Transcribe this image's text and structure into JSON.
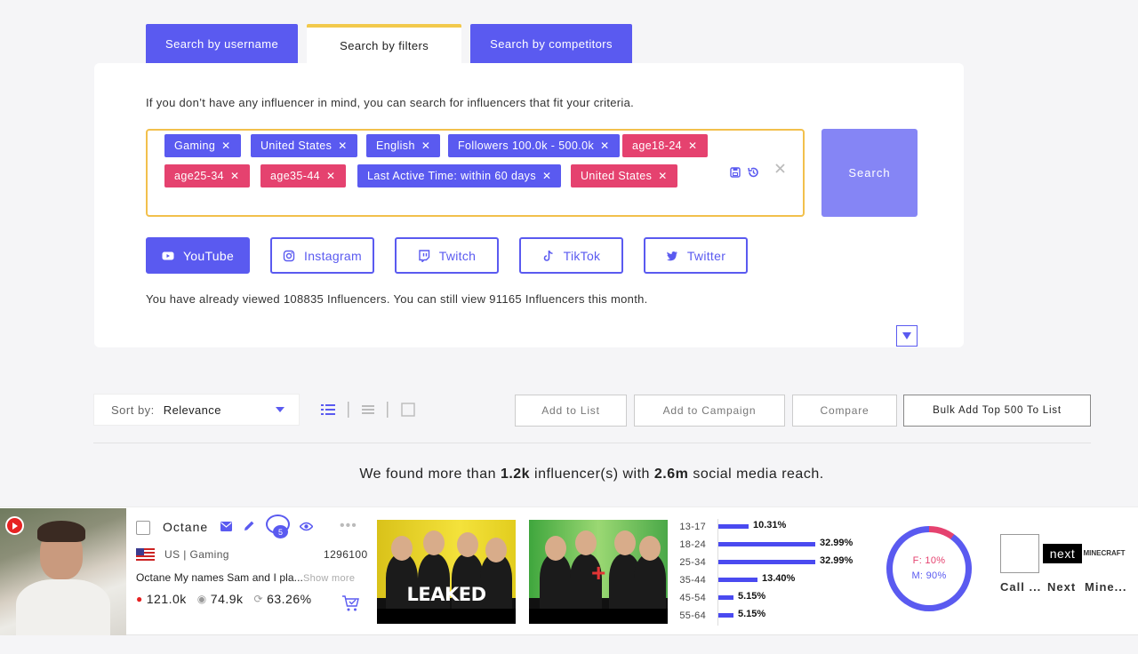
{
  "tabs": [
    {
      "label": "Search by username"
    },
    {
      "label": "Search by filters"
    },
    {
      "label": "Search by competitors"
    }
  ],
  "intro_text": "If you don’t have any influencer in mind, you can search for influencers that fit your criteria.",
  "filters": [
    {
      "label": "Gaming",
      "color": "#5a5af0"
    },
    {
      "label": "United States",
      "color": "#5a5af0"
    },
    {
      "label": "English",
      "color": "#5a5af0"
    },
    {
      "label": "Followers 100.0k - 500.0k",
      "color": "#5a5af0"
    },
    {
      "label": "age18-24",
      "color": "#e5426f"
    },
    {
      "label": "age25-34",
      "color": "#e5426f"
    },
    {
      "label": "age35-44",
      "color": "#e5426f"
    },
    {
      "label": "Last Active Time: within 60 days",
      "color": "#5a5af0"
    },
    {
      "label": "United States",
      "color": "#e5426f"
    }
  ],
  "remove_glyph": "✕",
  "search_button": "Search",
  "platforms": [
    {
      "label": "YouTube",
      "icon": "youtube-icon",
      "selected": true
    },
    {
      "label": "Instagram",
      "icon": "instagram-icon",
      "selected": false
    },
    {
      "label": "Twitch",
      "icon": "twitch-icon",
      "selected": false
    },
    {
      "label": "TikTok",
      "icon": "tiktok-icon",
      "selected": false
    },
    {
      "label": "Twitter",
      "icon": "twitter-icon",
      "selected": false
    }
  ],
  "viewed_text": "You have already viewed 108835 Influencers. You can still view 91165 Influencers this month.",
  "sort": {
    "label": "Sort by:",
    "value": "Relevance"
  },
  "actions": {
    "add_to_list": "Add to List",
    "add_to_campaign": "Add to Campaign",
    "compare": "Compare",
    "bulk_add": "Bulk Add Top 500 To List"
  },
  "results": {
    "prefix": "We found more than ",
    "count": "1.2k",
    "middle": " influencer(s) with ",
    "reach": "2.6m",
    "suffix": " social media reach."
  },
  "influencer": {
    "name": "Octane",
    "comment_count": "5",
    "country": "US | Gaming",
    "subscribers": "1296100",
    "description": "Octane My names Sam and I pla...",
    "show_more": "Show more",
    "followers": "121.0k",
    "avg_views": "74.9k",
    "engagement": "63.26%",
    "thumb1_text": "LEAKED",
    "thumb2_mark": "+",
    "ages": [
      {
        "label": "13-17",
        "value": "10.31%",
        "pct": 10.31
      },
      {
        "label": "18-24",
        "value": "32.99%",
        "pct": 32.99
      },
      {
        "label": "25-34",
        "value": "32.99%",
        "pct": 32.99
      },
      {
        "label": "35-44",
        "value": "13.40%",
        "pct": 13.4
      },
      {
        "label": "45-54",
        "value": "5.15%",
        "pct": 5.15
      },
      {
        "label": "55-64",
        "value": "5.15%",
        "pct": 5.15
      }
    ],
    "gender": {
      "female": "F: 10%",
      "male": "M: 90%",
      "female_pct": 10
    },
    "brands": [
      {
        "label": "Call ..."
      },
      {
        "label": "Next",
        "logo_text": "next"
      },
      {
        "label": "Mine...",
        "logo_text": "MINECRAFT"
      }
    ]
  },
  "colors": {
    "accent": "#5a5af0",
    "pink": "#e5426f",
    "yellow_border": "#f2c04c"
  }
}
